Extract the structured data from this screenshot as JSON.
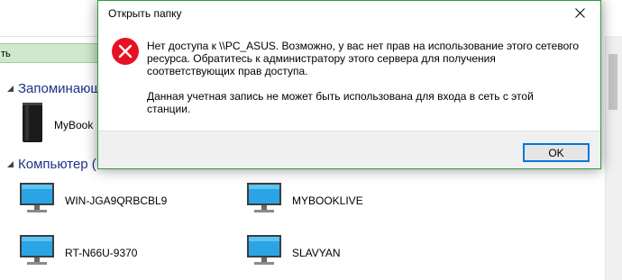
{
  "explorer": {
    "address_fragment": "ть",
    "groups": {
      "remembered": {
        "label": "Запоминающ"
      },
      "computers": {
        "label": "Компьютер ("
      }
    },
    "items": {
      "mybook": {
        "label": "MyBook",
        "icon": "external-drive-icon"
      },
      "win": {
        "label": "WIN-JGA9QRBCBL9",
        "icon": "computer-monitor-icon"
      },
      "mybooklive": {
        "label": "MYBOOKLIVE",
        "icon": "computer-monitor-icon"
      },
      "rt": {
        "label": "RT-N66U-9370",
        "icon": "computer-monitor-icon"
      },
      "slavyan": {
        "label": "SLAVYAN",
        "icon": "computer-monitor-icon"
      }
    }
  },
  "dialog": {
    "title": "Открыть папку",
    "message_1": "Нет доступа к \\\\PC_ASUS. Возможно, у вас нет прав на использование этого сетевого ресурса. Обратитесь к администратору этого сервера для получения соответствующих прав доступа.",
    "message_2": "Данная учетная запись не может быть использована для входа в сеть с этой станции.",
    "ok_label": "OK",
    "icon": "error-icon",
    "close_icon": "close-icon"
  },
  "colors": {
    "dialog_border": "#2f9e3d",
    "error_red": "#e81123",
    "ok_focus": "#0078d7",
    "group_header": "#1e3287"
  }
}
